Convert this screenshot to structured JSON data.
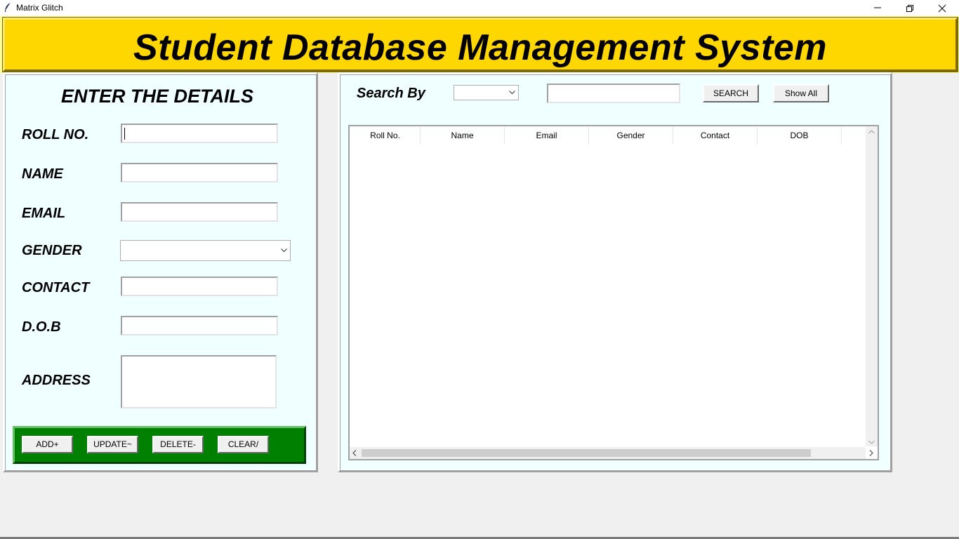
{
  "window": {
    "title": "Matrix Glitch",
    "icon": "feather-icon"
  },
  "header": {
    "title": "Student Database Management System",
    "bg_color": "#ffd700"
  },
  "form": {
    "heading": "ENTER THE DETAILS",
    "labels": {
      "roll": "ROLL NO.",
      "name": "NAME",
      "email": "EMAIL",
      "gender": "GENDER",
      "contact": "CONTACT",
      "dob": "D.O.B",
      "address": "ADDRESS"
    },
    "values": {
      "roll": "",
      "name": "",
      "email": "",
      "gender": "",
      "contact": "",
      "dob": "",
      "address": ""
    },
    "bg_color": "#f0ffff"
  },
  "actions": {
    "add": "ADD+",
    "update": "UPDATE~",
    "delete": "DELETE-",
    "clear": "CLEAR/",
    "frame_color": "#008000"
  },
  "search": {
    "label": "Search By",
    "by_value": "",
    "text_value": "",
    "search_button": "SEARCH",
    "show_all_button": "Show All"
  },
  "table": {
    "columns": [
      "Roll No.",
      "Name",
      "Email",
      "Gender",
      "Contact",
      "DOB"
    ],
    "rows": []
  }
}
